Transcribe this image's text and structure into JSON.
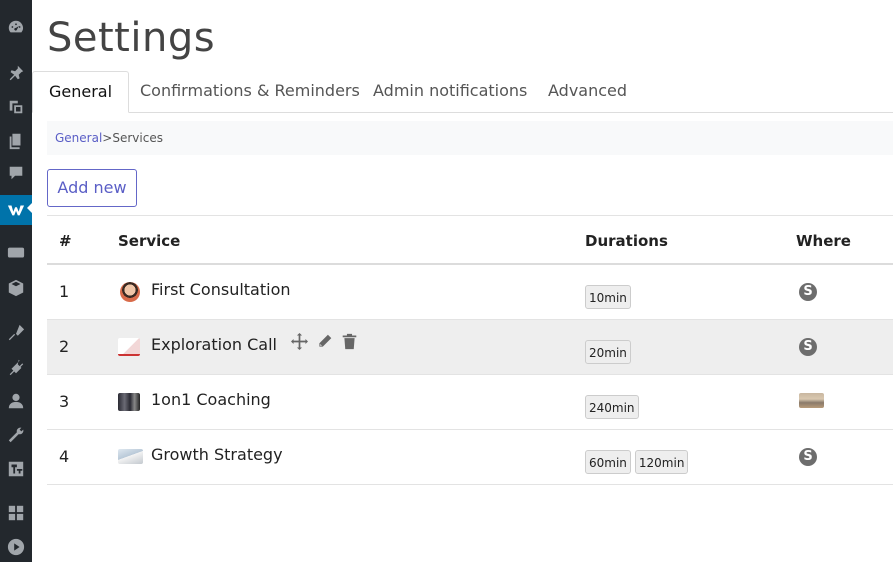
{
  "page": {
    "title": "Settings"
  },
  "tabs": [
    {
      "label": "General",
      "active": true
    },
    {
      "label": "Confirmations & Reminders",
      "active": false
    },
    {
      "label": "Admin notifications",
      "active": false
    },
    {
      "label": "Advanced",
      "active": false
    }
  ],
  "breadcrumb": {
    "link": "General",
    "separator": ">",
    "current": "Services"
  },
  "add_button": {
    "label": "Add new"
  },
  "table": {
    "headers": {
      "num": "#",
      "service": "Service",
      "durations": "Durations",
      "where": "Where"
    },
    "rows": [
      {
        "num": "1",
        "name": "First Consultation",
        "durations": [
          "10min"
        ],
        "where": "skype"
      },
      {
        "num": "2",
        "name": "Exploration Call",
        "durations": [
          "20min"
        ],
        "where": "skype"
      },
      {
        "num": "3",
        "name": "1on1 Coaching",
        "durations": [
          "240min"
        ],
        "where": "photo"
      },
      {
        "num": "4",
        "name": "Growth Strategy",
        "durations": [
          "60min",
          "120min"
        ],
        "where": "skype"
      }
    ]
  },
  "colors": {
    "admin_bar": "#23282d",
    "active_menu": "#0073aa",
    "accent": "#5a5ec6"
  }
}
